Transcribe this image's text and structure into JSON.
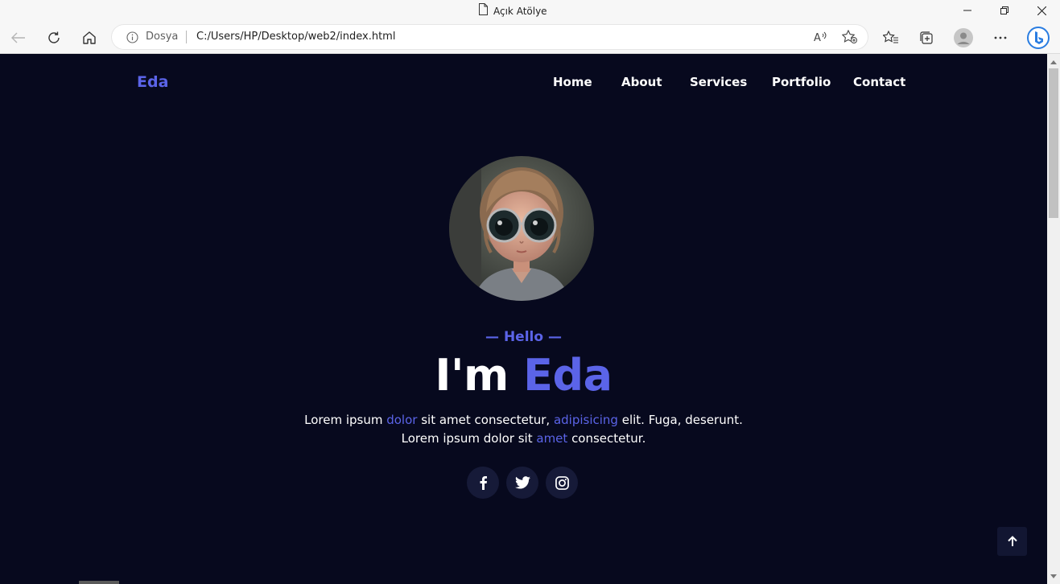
{
  "window": {
    "title": "Açık Atölye",
    "controls": {
      "minimize": "minimize",
      "restore": "restore",
      "close": "close"
    }
  },
  "toolbar": {
    "address": {
      "security_label": "Dosya",
      "url": "C:/Users/HP/Desktop/web2/index.html"
    },
    "icons": [
      "back-arrow-icon",
      "refresh-icon",
      "home-icon",
      "info-icon",
      "read-aloud-icon",
      "add-favorite-icon",
      "favorites-icon",
      "collections-icon",
      "profile-icon",
      "more-icon",
      "bing-icon"
    ]
  },
  "site": {
    "logo": "Eda",
    "nav": [
      "Home",
      "About",
      "Services",
      "Portfolio",
      "Contact"
    ],
    "hero": {
      "hello": "— Hello —",
      "headline_prefix": "I'm",
      "headline_name": "Eda",
      "line1": {
        "p1": "Lorem ipsum ",
        "h1": "dolor",
        "p2": " sit amet consectetur, ",
        "h2": "adipisicing",
        "p3": " elit. Fuga, deserunt."
      },
      "line2": {
        "p1": "Lorem ipsum dolor sit ",
        "h1": "amet",
        "p2": " consectetur."
      },
      "socials": [
        "facebook-icon",
        "twitter-icon",
        "instagram-icon"
      ]
    }
  },
  "colors": {
    "background": "#07091e",
    "accent": "#5b64e8",
    "text": "#ffffff",
    "chrome": "#f7f7f7"
  }
}
